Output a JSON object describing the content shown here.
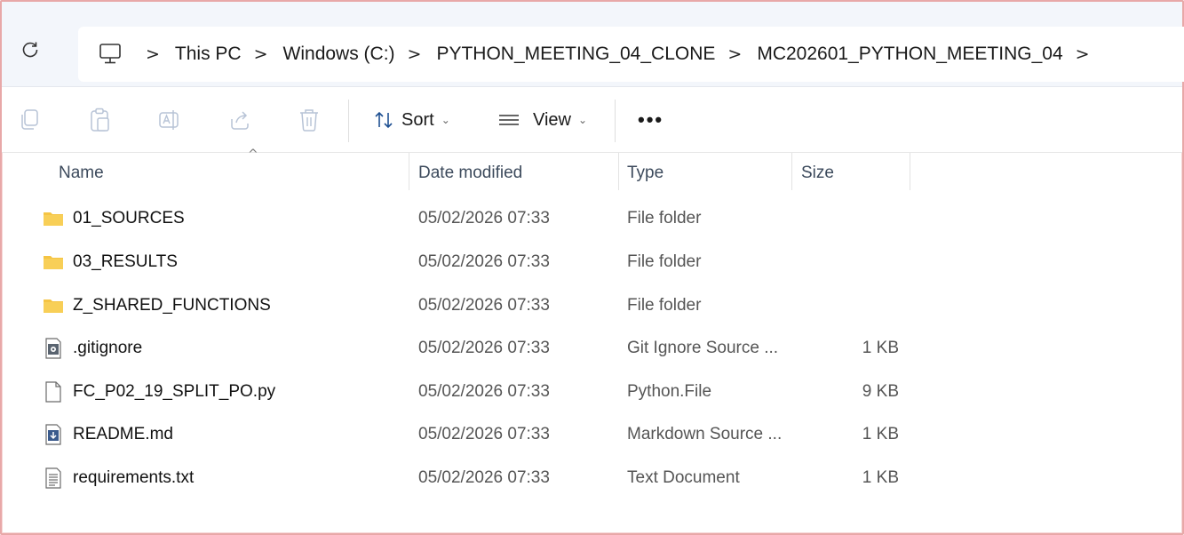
{
  "address_bar": {
    "breadcrumbs": [
      "This PC",
      "Windows (C:)",
      "PYTHON_MEETING_04_CLONE",
      "MC202601_PYTHON_MEETING_04"
    ],
    "separator": ">"
  },
  "toolbar": {
    "sort_label": "Sort",
    "view_label": "View",
    "more_label": "•••"
  },
  "columns": {
    "name": "Name",
    "date_modified": "Date modified",
    "type": "Type",
    "size": "Size"
  },
  "files": [
    {
      "name": "01_SOURCES",
      "date": "05/02/2026 07:33",
      "type": "File folder",
      "size": "",
      "icon": "folder-icon"
    },
    {
      "name": "03_RESULTS",
      "date": "05/02/2026 07:33",
      "type": "File folder",
      "size": "",
      "icon": "folder-icon"
    },
    {
      "name": "Z_SHARED_FUNCTIONS",
      "date": "05/02/2026 07:33",
      "type": "File folder",
      "size": "",
      "icon": "folder-icon"
    },
    {
      "name": ".gitignore",
      "date": "05/02/2026 07:33",
      "type": "Git Ignore Source ...",
      "size": "1 KB",
      "icon": "settings-file-icon"
    },
    {
      "name": "FC_P02_19_SPLIT_PO.py",
      "date": "05/02/2026 07:33",
      "type": "Python.File",
      "size": "9 KB",
      "icon": "blank-file-icon"
    },
    {
      "name": "README.md",
      "date": "05/02/2026 07:33",
      "type": "Markdown Source ...",
      "size": "1 KB",
      "icon": "markdown-file-icon"
    },
    {
      "name": "requirements.txt",
      "date": "05/02/2026 07:33",
      "type": "Text Document",
      "size": "1 KB",
      "icon": "text-file-icon"
    }
  ],
  "colors": {
    "folder": "#f5c443",
    "address_bg": "#f3f6fb",
    "frame_border": "#e8a8a8"
  }
}
